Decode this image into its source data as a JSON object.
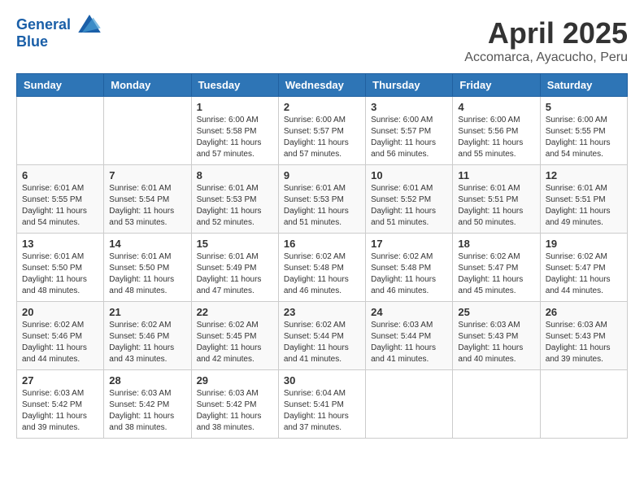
{
  "logo": {
    "line1": "General",
    "line2": "Blue"
  },
  "title": "April 2025",
  "subtitle": "Accomarca, Ayacucho, Peru",
  "days_of_week": [
    "Sunday",
    "Monday",
    "Tuesday",
    "Wednesday",
    "Thursday",
    "Friday",
    "Saturday"
  ],
  "weeks": [
    [
      {
        "day": "",
        "detail": ""
      },
      {
        "day": "",
        "detail": ""
      },
      {
        "day": "1",
        "detail": "Sunrise: 6:00 AM\nSunset: 5:58 PM\nDaylight: 11 hours and 57 minutes."
      },
      {
        "day": "2",
        "detail": "Sunrise: 6:00 AM\nSunset: 5:57 PM\nDaylight: 11 hours and 57 minutes."
      },
      {
        "day": "3",
        "detail": "Sunrise: 6:00 AM\nSunset: 5:57 PM\nDaylight: 11 hours and 56 minutes."
      },
      {
        "day": "4",
        "detail": "Sunrise: 6:00 AM\nSunset: 5:56 PM\nDaylight: 11 hours and 55 minutes."
      },
      {
        "day": "5",
        "detail": "Sunrise: 6:00 AM\nSunset: 5:55 PM\nDaylight: 11 hours and 54 minutes."
      }
    ],
    [
      {
        "day": "6",
        "detail": "Sunrise: 6:01 AM\nSunset: 5:55 PM\nDaylight: 11 hours and 54 minutes."
      },
      {
        "day": "7",
        "detail": "Sunrise: 6:01 AM\nSunset: 5:54 PM\nDaylight: 11 hours and 53 minutes."
      },
      {
        "day": "8",
        "detail": "Sunrise: 6:01 AM\nSunset: 5:53 PM\nDaylight: 11 hours and 52 minutes."
      },
      {
        "day": "9",
        "detail": "Sunrise: 6:01 AM\nSunset: 5:53 PM\nDaylight: 11 hours and 51 minutes."
      },
      {
        "day": "10",
        "detail": "Sunrise: 6:01 AM\nSunset: 5:52 PM\nDaylight: 11 hours and 51 minutes."
      },
      {
        "day": "11",
        "detail": "Sunrise: 6:01 AM\nSunset: 5:51 PM\nDaylight: 11 hours and 50 minutes."
      },
      {
        "day": "12",
        "detail": "Sunrise: 6:01 AM\nSunset: 5:51 PM\nDaylight: 11 hours and 49 minutes."
      }
    ],
    [
      {
        "day": "13",
        "detail": "Sunrise: 6:01 AM\nSunset: 5:50 PM\nDaylight: 11 hours and 48 minutes."
      },
      {
        "day": "14",
        "detail": "Sunrise: 6:01 AM\nSunset: 5:50 PM\nDaylight: 11 hours and 48 minutes."
      },
      {
        "day": "15",
        "detail": "Sunrise: 6:01 AM\nSunset: 5:49 PM\nDaylight: 11 hours and 47 minutes."
      },
      {
        "day": "16",
        "detail": "Sunrise: 6:02 AM\nSunset: 5:48 PM\nDaylight: 11 hours and 46 minutes."
      },
      {
        "day": "17",
        "detail": "Sunrise: 6:02 AM\nSunset: 5:48 PM\nDaylight: 11 hours and 46 minutes."
      },
      {
        "day": "18",
        "detail": "Sunrise: 6:02 AM\nSunset: 5:47 PM\nDaylight: 11 hours and 45 minutes."
      },
      {
        "day": "19",
        "detail": "Sunrise: 6:02 AM\nSunset: 5:47 PM\nDaylight: 11 hours and 44 minutes."
      }
    ],
    [
      {
        "day": "20",
        "detail": "Sunrise: 6:02 AM\nSunset: 5:46 PM\nDaylight: 11 hours and 44 minutes."
      },
      {
        "day": "21",
        "detail": "Sunrise: 6:02 AM\nSunset: 5:46 PM\nDaylight: 11 hours and 43 minutes."
      },
      {
        "day": "22",
        "detail": "Sunrise: 6:02 AM\nSunset: 5:45 PM\nDaylight: 11 hours and 42 minutes."
      },
      {
        "day": "23",
        "detail": "Sunrise: 6:02 AM\nSunset: 5:44 PM\nDaylight: 11 hours and 41 minutes."
      },
      {
        "day": "24",
        "detail": "Sunrise: 6:03 AM\nSunset: 5:44 PM\nDaylight: 11 hours and 41 minutes."
      },
      {
        "day": "25",
        "detail": "Sunrise: 6:03 AM\nSunset: 5:43 PM\nDaylight: 11 hours and 40 minutes."
      },
      {
        "day": "26",
        "detail": "Sunrise: 6:03 AM\nSunset: 5:43 PM\nDaylight: 11 hours and 39 minutes."
      }
    ],
    [
      {
        "day": "27",
        "detail": "Sunrise: 6:03 AM\nSunset: 5:42 PM\nDaylight: 11 hours and 39 minutes."
      },
      {
        "day": "28",
        "detail": "Sunrise: 6:03 AM\nSunset: 5:42 PM\nDaylight: 11 hours and 38 minutes."
      },
      {
        "day": "29",
        "detail": "Sunrise: 6:03 AM\nSunset: 5:42 PM\nDaylight: 11 hours and 38 minutes."
      },
      {
        "day": "30",
        "detail": "Sunrise: 6:04 AM\nSunset: 5:41 PM\nDaylight: 11 hours and 37 minutes."
      },
      {
        "day": "",
        "detail": ""
      },
      {
        "day": "",
        "detail": ""
      },
      {
        "day": "",
        "detail": ""
      }
    ]
  ]
}
